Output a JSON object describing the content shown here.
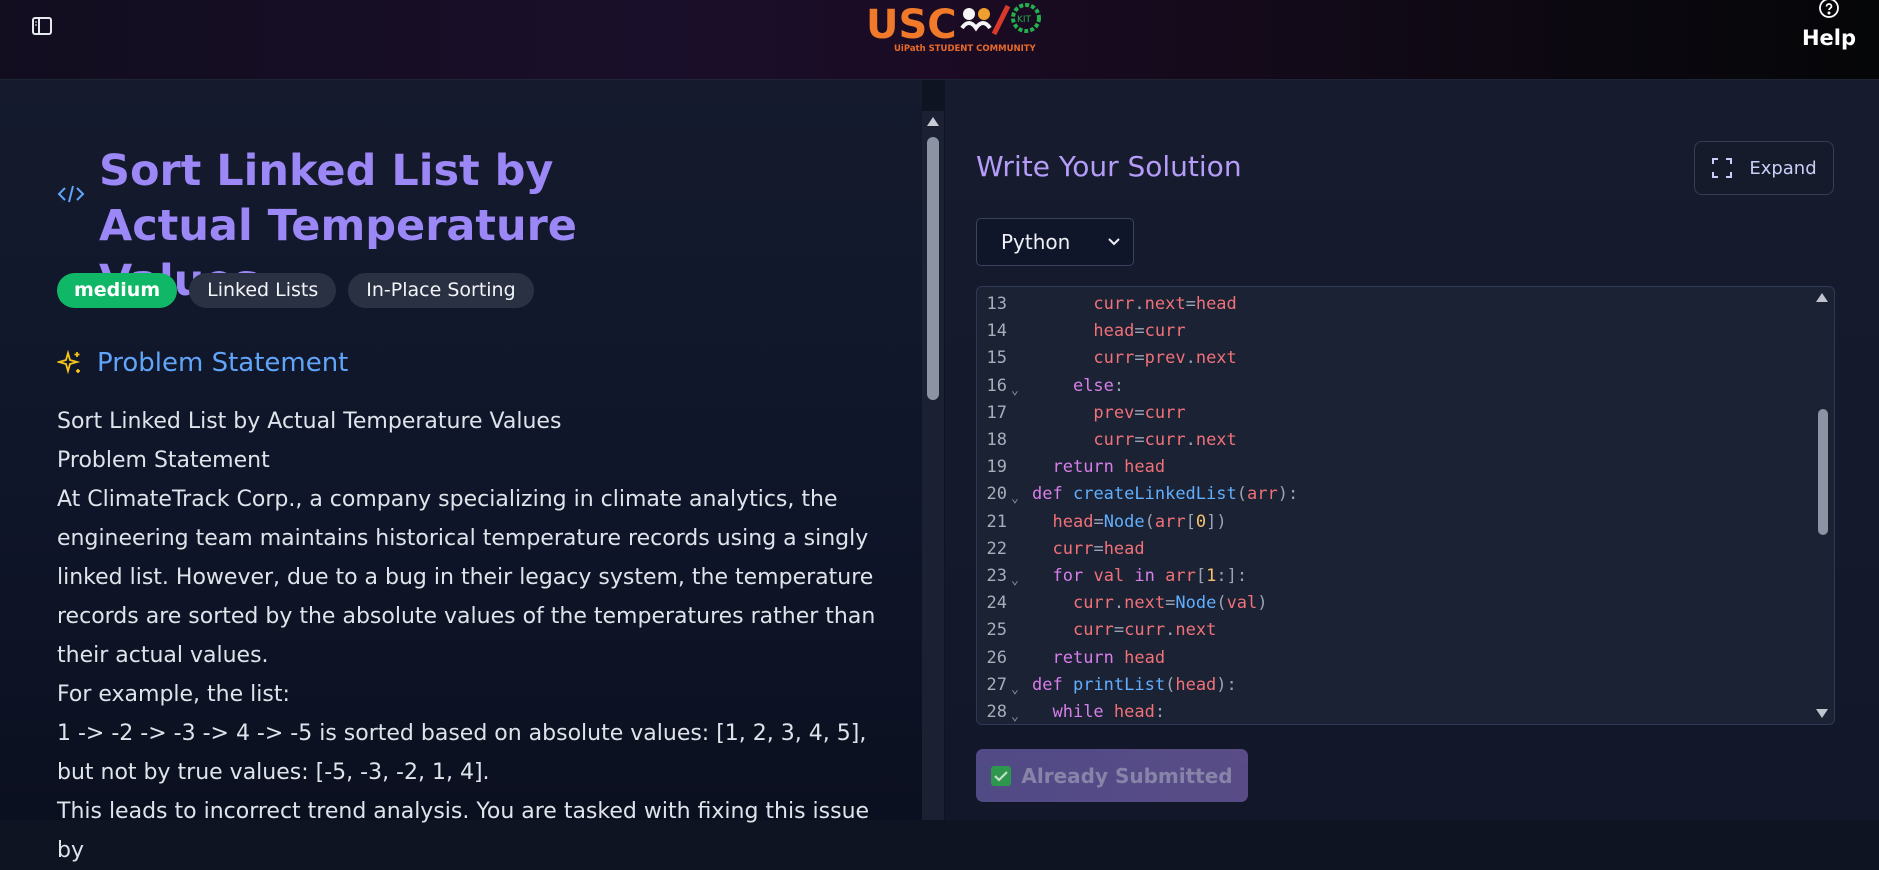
{
  "header": {
    "logo": {
      "text": "USC",
      "subtitle": "UiPath STUDENT COMMUNITY"
    },
    "help_label": "Help"
  },
  "problem": {
    "title": "Sort Linked List by Actual Temperature Values",
    "difficulty": "medium",
    "tags": [
      "Linked Lists",
      "In-Place Sorting"
    ],
    "section_title": "Problem Statement",
    "paragraphs": [
      "Sort Linked List by Actual Temperature Values",
      "Problem Statement",
      "At ClimateTrack Corp., a company specializing in climate analytics, the engineering team maintains historical temperature records using a singly linked list. However, due to a bug in their legacy system, the temperature records are sorted by the absolute values of the temperatures rather than their actual values.",
      "For example, the list:",
      "1 -> -2 -> -3 -> 4 -> -5 is sorted based on absolute values: [1, 2, 3, 4, 5], but not by true values: [-5, -3, -2, 1, 4].",
      "This leads to incorrect trend analysis. You are tasked with fixing this issue by"
    ]
  },
  "solution": {
    "title": "Write Your Solution",
    "expand_label": "Expand",
    "language": "Python",
    "submit_label": "Already Submitted",
    "code_lines": [
      {
        "n": "13",
        "fold": false,
        "code": "      curr.next=head"
      },
      {
        "n": "14",
        "fold": false,
        "code": "      head=curr"
      },
      {
        "n": "15",
        "fold": false,
        "code": "      curr=prev.next"
      },
      {
        "n": "16",
        "fold": true,
        "code": "    else:"
      },
      {
        "n": "17",
        "fold": false,
        "code": "      prev=curr"
      },
      {
        "n": "18",
        "fold": false,
        "code": "      curr=curr.next"
      },
      {
        "n": "19",
        "fold": false,
        "code": "  return head"
      },
      {
        "n": "20",
        "fold": true,
        "code": "def createLinkedList(arr):"
      },
      {
        "n": "21",
        "fold": false,
        "code": "  head=Node(arr[0])"
      },
      {
        "n": "22",
        "fold": false,
        "code": "  curr=head"
      },
      {
        "n": "23",
        "fold": true,
        "code": "  for val in arr[1:]:"
      },
      {
        "n": "24",
        "fold": false,
        "code": "    curr.next=Node(val)"
      },
      {
        "n": "25",
        "fold": false,
        "code": "    curr=curr.next"
      },
      {
        "n": "26",
        "fold": false,
        "code": "  return head"
      },
      {
        "n": "27",
        "fold": true,
        "code": "def printList(head):"
      },
      {
        "n": "28",
        "fold": true,
        "code": "  while head:"
      }
    ]
  },
  "colors": {
    "accent_purple": "#9b87f5",
    "section_blue": "#60a5fa",
    "difficulty_green": "#10b766"
  }
}
